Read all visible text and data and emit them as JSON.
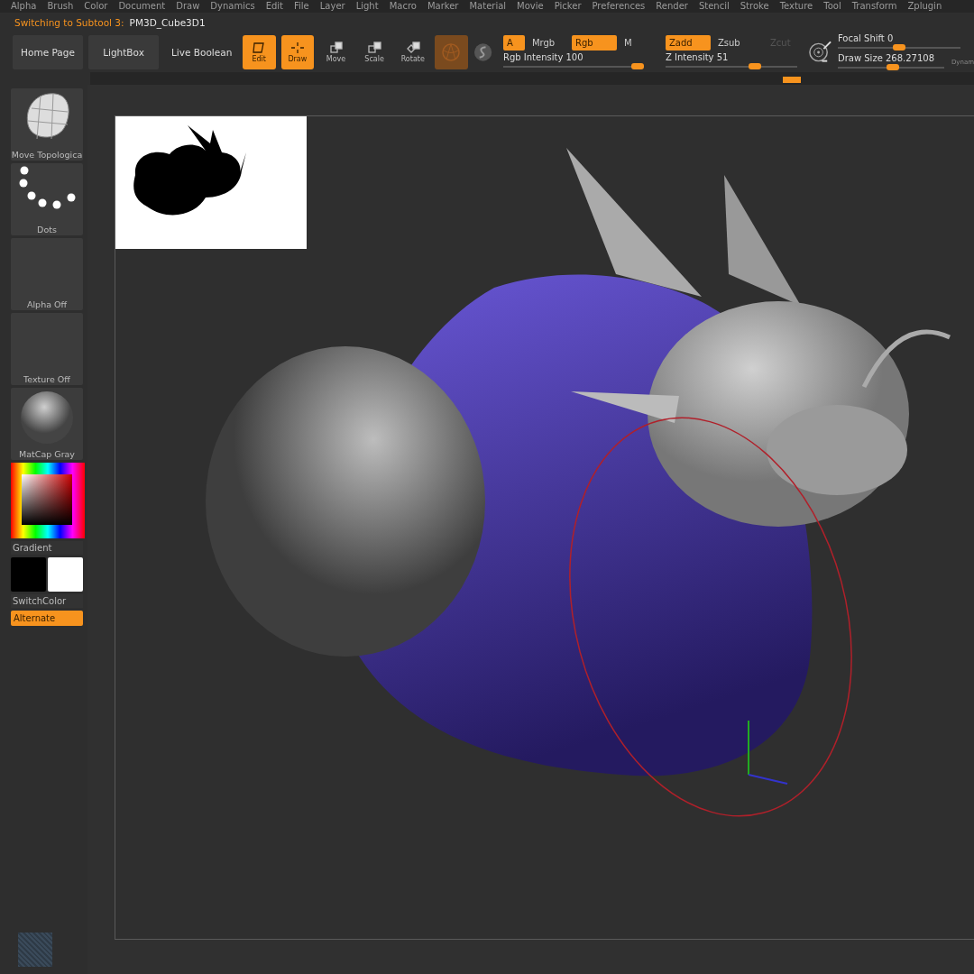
{
  "menu": [
    "Alpha",
    "Brush",
    "Color",
    "Document",
    "Draw",
    "Dynamics",
    "Edit",
    "File",
    "Layer",
    "Light",
    "Macro",
    "Marker",
    "Material",
    "Movie",
    "Picker",
    "Preferences",
    "Render",
    "Stencil",
    "Stroke",
    "Texture",
    "Tool",
    "Transform",
    "Zplugin"
  ],
  "status": {
    "message": "Switching to Subtool 3:",
    "subtool": "PM3D_Cube3D1"
  },
  "toolbar": {
    "buttons": [
      "Home Page",
      "LightBox",
      "Live Boolean"
    ],
    "modes": [
      {
        "kind": "edit",
        "label": "Edit",
        "selected": true
      },
      {
        "kind": "draw",
        "label": "Draw",
        "selected": true
      },
      {
        "kind": "move",
        "label": "Move",
        "selected": false
      },
      {
        "kind": "scale",
        "label": "Scale",
        "selected": false
      },
      {
        "kind": "rotate",
        "label": "Rotate",
        "selected": false
      }
    ],
    "channels": [
      {
        "label": "A",
        "selected": true,
        "disabled": false
      },
      {
        "label": "Mrgb",
        "selected": false,
        "disabled": false
      },
      {
        "label": "Rgb",
        "selected": true,
        "disabled": false
      },
      {
        "label": "M",
        "selected": false,
        "disabled": false
      },
      {
        "label": "Zadd",
        "selected": true,
        "disabled": false
      },
      {
        "label": "Zsub",
        "selected": false,
        "disabled": false
      },
      {
        "label": "Zcut",
        "selected": false,
        "disabled": true
      }
    ],
    "intensity_sliders": [
      {
        "label": "Rgb Intensity 100",
        "level": 1.0
      },
      {
        "label": "Z Intensity 51",
        "level": 0.7
      }
    ],
    "brush_sliders": [
      {
        "label": "Focal Shift 0",
        "level": 0.5
      },
      {
        "label": "Draw Size 268.27108",
        "level": 0.52
      }
    ],
    "dynamic_label": "Dynam"
  },
  "shelf": {
    "tiles": [
      {
        "kind": "brush",
        "label": "Move Topologica"
      },
      {
        "kind": "stroke",
        "label": "Dots"
      },
      {
        "kind": "empty",
        "label": "Alpha Off"
      },
      {
        "kind": "empty",
        "label": "Texture Off"
      },
      {
        "kind": "matcap",
        "label": "MatCap Gray"
      }
    ],
    "gradient_label": "Gradient",
    "switch_label": "SwitchColor",
    "alternate": {
      "label": "Alternate",
      "on": true
    }
  }
}
